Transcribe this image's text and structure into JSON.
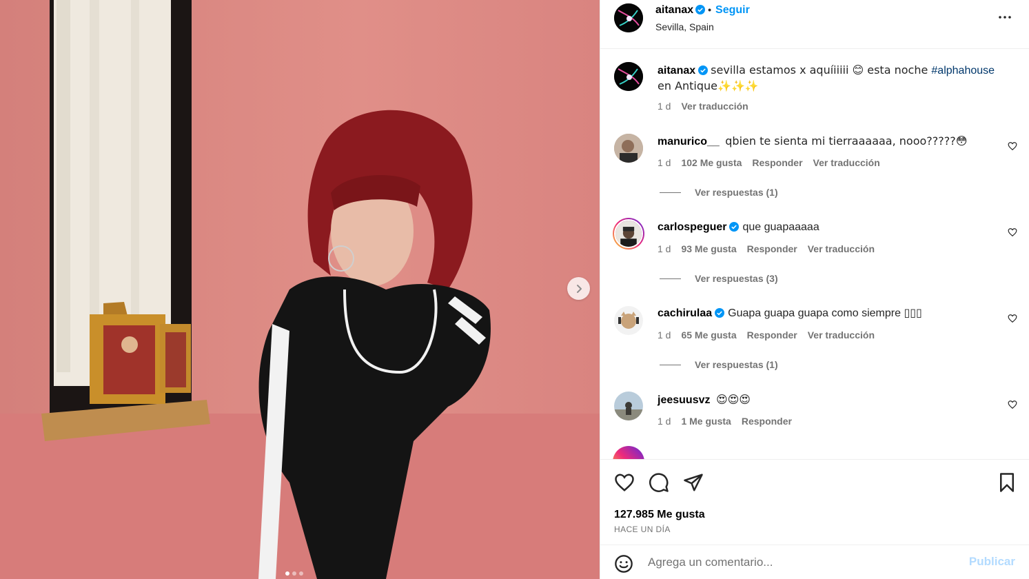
{
  "post": {
    "author": "aitanax",
    "follow_label": "Seguir",
    "bullet": "•",
    "location": "Sevilla, Spain",
    "more_icon": "more-horizontal-icon"
  },
  "caption": {
    "username": "aitanax",
    "text_before": "sevilla estamos x aquíiiiii 😊 esta noche ",
    "hashtag": "#alphahouse",
    "text_after": "en Antique✨✨✨",
    "time": "1 d",
    "translate": "Ver traducción"
  },
  "comments": [
    {
      "username": "manurico__",
      "text": "qbien te sienta mi tierraaaaaa, nooo?????😳",
      "time": "1 d",
      "likes": "102 Me gusta",
      "reply": "Responder",
      "translate": "Ver traducción",
      "replies": "Ver respuestas (1)",
      "verified": false
    },
    {
      "username": "carlospeguer",
      "text": "que guapaaaaa",
      "time": "1 d",
      "likes": "93 Me gusta",
      "reply": "Responder",
      "translate": "Ver traducción",
      "replies": "Ver respuestas (3)",
      "verified": true
    },
    {
      "username": "cachirulaa",
      "text": "Guapa guapa guapa como siempre ▯▯▯",
      "time": "1 d",
      "likes": "65 Me gusta",
      "reply": "Responder",
      "translate": "Ver traducción",
      "replies": "Ver respuestas (1)",
      "verified": true
    },
    {
      "username": "jeesuusvz",
      "text": "😍😍😍",
      "time": "1 d",
      "likes": "1 Me gusta",
      "reply": "Responder",
      "verified": false
    }
  ],
  "footer": {
    "likes": "127.985 Me gusta",
    "date": "HACE UN DÍA",
    "placeholder": "Agrega un comentario...",
    "publish": "Publicar"
  },
  "carousel": {
    "total": 3,
    "active": 1
  },
  "colors": {
    "accent": "#0095f6",
    "wall": "#d98a84",
    "hair": "#8b1a1f"
  }
}
